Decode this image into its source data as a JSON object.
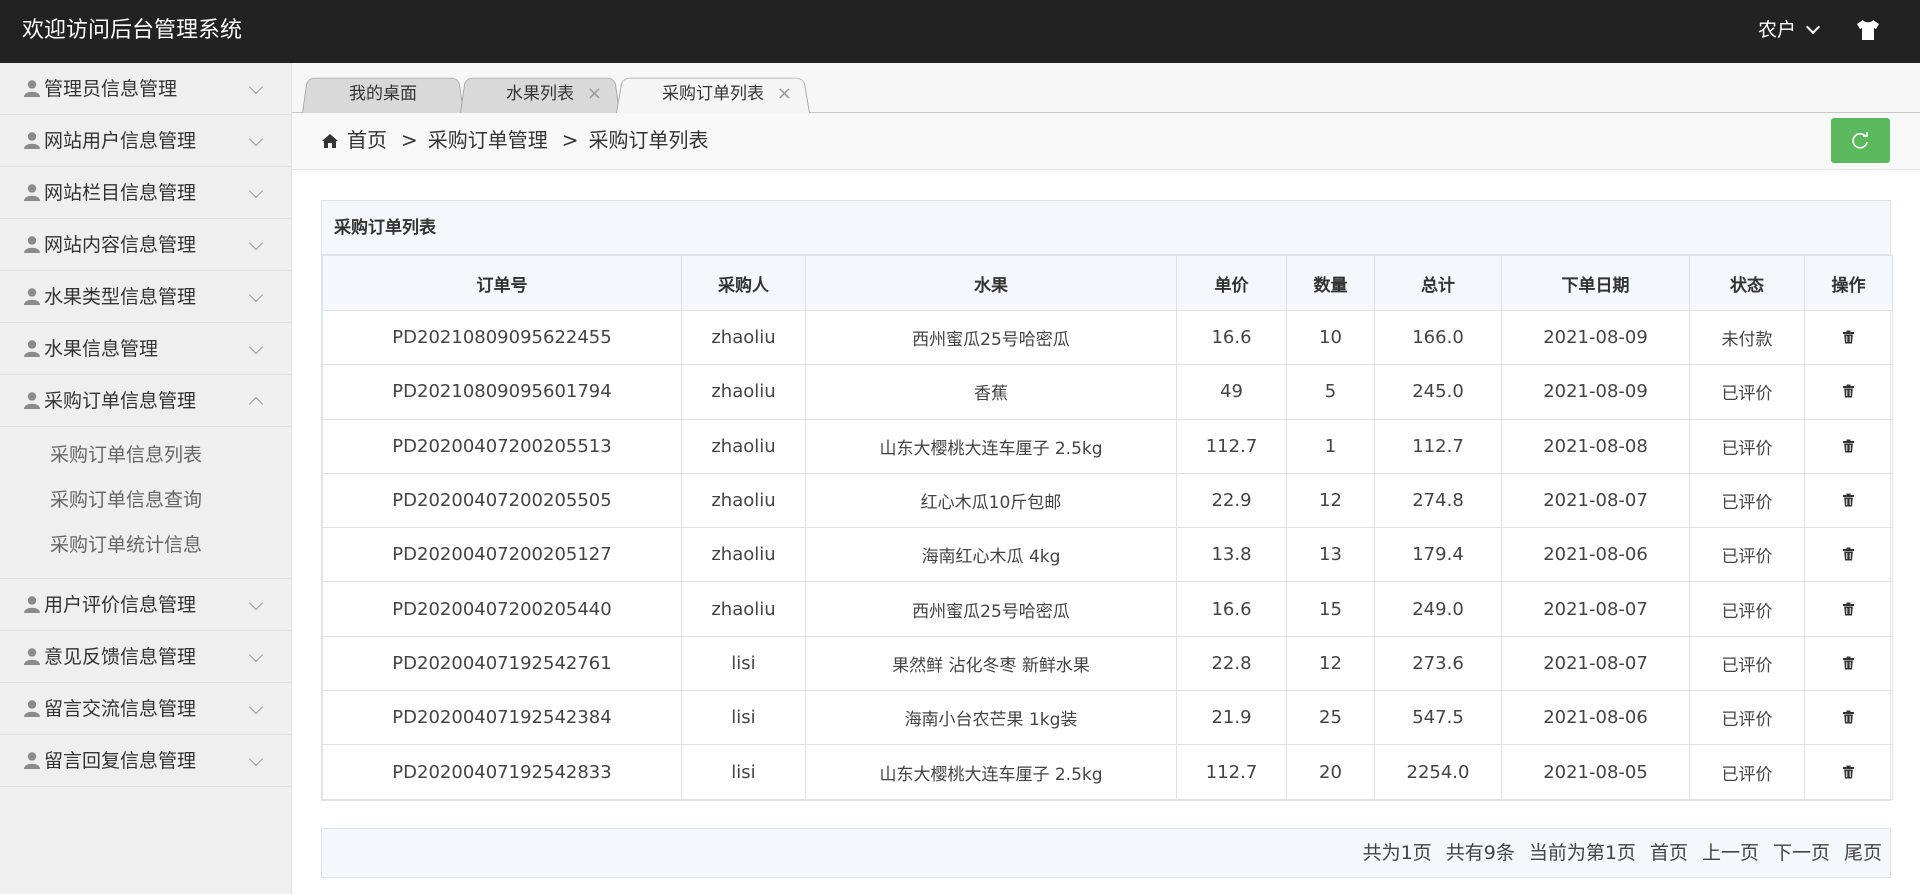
{
  "header": {
    "title": "欢迎访问后台管理系统",
    "user": "农户"
  },
  "sidebar": {
    "items": [
      {
        "label": "管理员信息管理",
        "expanded": false
      },
      {
        "label": "网站用户信息管理",
        "expanded": false
      },
      {
        "label": "网站栏目信息管理",
        "expanded": false
      },
      {
        "label": "网站内容信息管理",
        "expanded": false
      },
      {
        "label": "水果类型信息管理",
        "expanded": false
      },
      {
        "label": "水果信息管理",
        "expanded": false
      },
      {
        "label": "采购订单信息管理",
        "expanded": true,
        "children": [
          "采购订单信息列表",
          "采购订单信息查询",
          "采购订单统计信息"
        ]
      },
      {
        "label": "用户评价信息管理",
        "expanded": false
      },
      {
        "label": "意见反馈信息管理",
        "expanded": false
      },
      {
        "label": "留言交流信息管理",
        "expanded": false
      },
      {
        "label": "留言回复信息管理",
        "expanded": false
      }
    ]
  },
  "tabs": [
    {
      "label": "我的桌面",
      "closable": false,
      "active": false
    },
    {
      "label": "水果列表",
      "closable": true,
      "active": false
    },
    {
      "label": "采购订单列表",
      "closable": true,
      "active": true
    }
  ],
  "tab_close_glyph": "×",
  "breadcrumb": {
    "home": "首页",
    "sep": ">",
    "level1": "采购订单管理",
    "level2": "采购订单列表"
  },
  "panel": {
    "title": "采购订单列表"
  },
  "table": {
    "columns": [
      "订单号",
      "采购人",
      "水果",
      "单价",
      "数量",
      "总计",
      "下单日期",
      "状态",
      "操作"
    ],
    "rows": [
      [
        "PD20210809095622455",
        "zhaoliu",
        "西州蜜瓜25号哈密瓜",
        "16.6",
        "10",
        "166.0",
        "2021-08-09",
        "未付款"
      ],
      [
        "PD20210809095601794",
        "zhaoliu",
        "香蕉",
        "49",
        "5",
        "245.0",
        "2021-08-09",
        "已评价"
      ],
      [
        "PD20200407200205513",
        "zhaoliu",
        "山东大樱桃大连车厘子 2.5kg",
        "112.7",
        "1",
        "112.7",
        "2021-08-08",
        "已评价"
      ],
      [
        "PD20200407200205505",
        "zhaoliu",
        "红心木瓜10斤包邮",
        "22.9",
        "12",
        "274.8",
        "2021-08-07",
        "已评价"
      ],
      [
        "PD20200407200205127",
        "zhaoliu",
        "海南红心木瓜 4kg",
        "13.8",
        "13",
        "179.4",
        "2021-08-06",
        "已评价"
      ],
      [
        "PD20200407200205440",
        "zhaoliu",
        "西州蜜瓜25号哈密瓜",
        "16.6",
        "15",
        "249.0",
        "2021-08-07",
        "已评价"
      ],
      [
        "PD20200407192542761",
        "lisi",
        "果然鲜 沾化冬枣 新鲜水果",
        "22.8",
        "12",
        "273.6",
        "2021-08-07",
        "已评价"
      ],
      [
        "PD20200407192542384",
        "lisi",
        "海南小台农芒果 1kg装",
        "21.9",
        "25",
        "547.5",
        "2021-08-06",
        "已评价"
      ],
      [
        "PD20200407192542833",
        "lisi",
        "山东大樱桃大连车厘子 2.5kg",
        "112.7",
        "20",
        "2254.0",
        "2021-08-05",
        "已评价"
      ]
    ]
  },
  "pager": {
    "total_pages": "共为1页",
    "total_items": "共有9条",
    "current": "当前为第1页",
    "first": "首页",
    "prev": "上一页",
    "next": "下一页",
    "last": "尾页"
  },
  "colors": {
    "header_bg": "#222222",
    "refresh_button": "#5cb85c",
    "table_header_bg": "#f4f7fb"
  }
}
